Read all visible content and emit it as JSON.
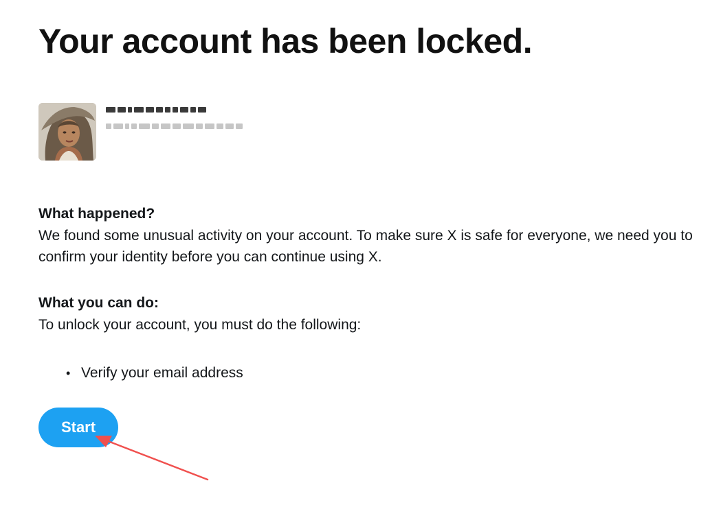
{
  "title": "Your account has been locked.",
  "account": {
    "avatar_alt": "avatar",
    "name_redacted": "",
    "handle_redacted": ""
  },
  "what_happened": {
    "heading": "What happened?",
    "body": "We found some unusual activity on your account. To make sure X is safe for everyone, we need you to confirm your identity before you can continue using X."
  },
  "what_you_can_do": {
    "heading": "What you can do:",
    "body": "To unlock your account, you must do the following:",
    "items": [
      "Verify your email address"
    ]
  },
  "start_button": {
    "label": "Start"
  },
  "colors": {
    "button_bg": "#1da1f2",
    "arrow": "#f0504e"
  }
}
